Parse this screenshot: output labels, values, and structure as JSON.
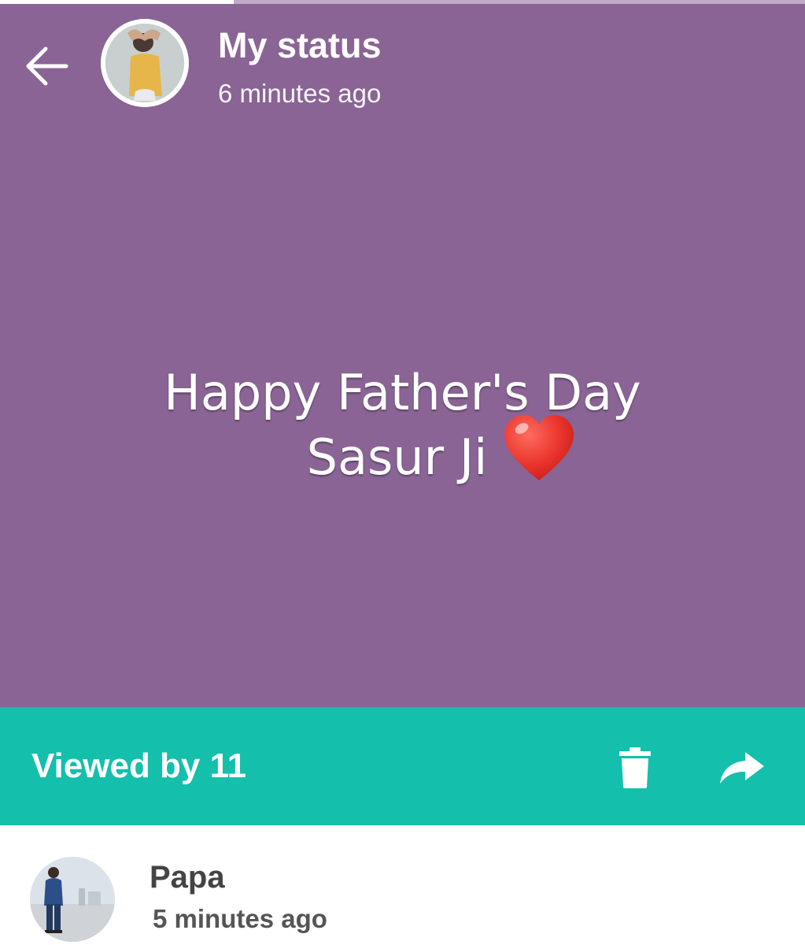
{
  "status": {
    "progress": 0.29,
    "title": "My status",
    "time": "6 minutes ago",
    "background_color": "#8a6495",
    "text_line1": "Happy Father's Day",
    "text_line2": "Sasur Ji",
    "emoji": "heart"
  },
  "icons": {
    "back": "arrow-left-icon",
    "delete": "trash-icon",
    "forward": "share-arrow-icon"
  },
  "viewed_bar": {
    "label": "Viewed by 11",
    "background_color": "#14bfac"
  },
  "viewer": {
    "name": "Papa",
    "time": "5 minutes ago"
  }
}
